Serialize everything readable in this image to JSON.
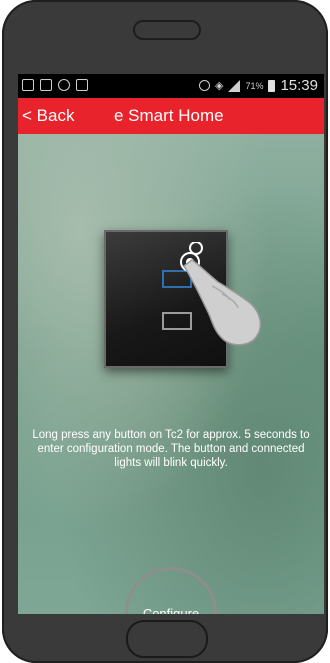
{
  "status_bar": {
    "battery_percent": "71%",
    "time": "15:39"
  },
  "app_bar": {
    "back_label": "< Back",
    "title": "e Smart Home"
  },
  "illustration": {
    "device": "Tc2 touch switch",
    "icons": [
      "hand-pointer-icon",
      "touch-icon"
    ]
  },
  "main": {
    "instruction": "Long press any button on Tc2 for approx. 5 seconds to enter configuration mode. The button and connected lights will blink quickly.",
    "configure_label": "Configure"
  },
  "colors": {
    "accent": "#e8232b",
    "status_bar": "#000000",
    "phone_frame": "#3a3a3a"
  }
}
